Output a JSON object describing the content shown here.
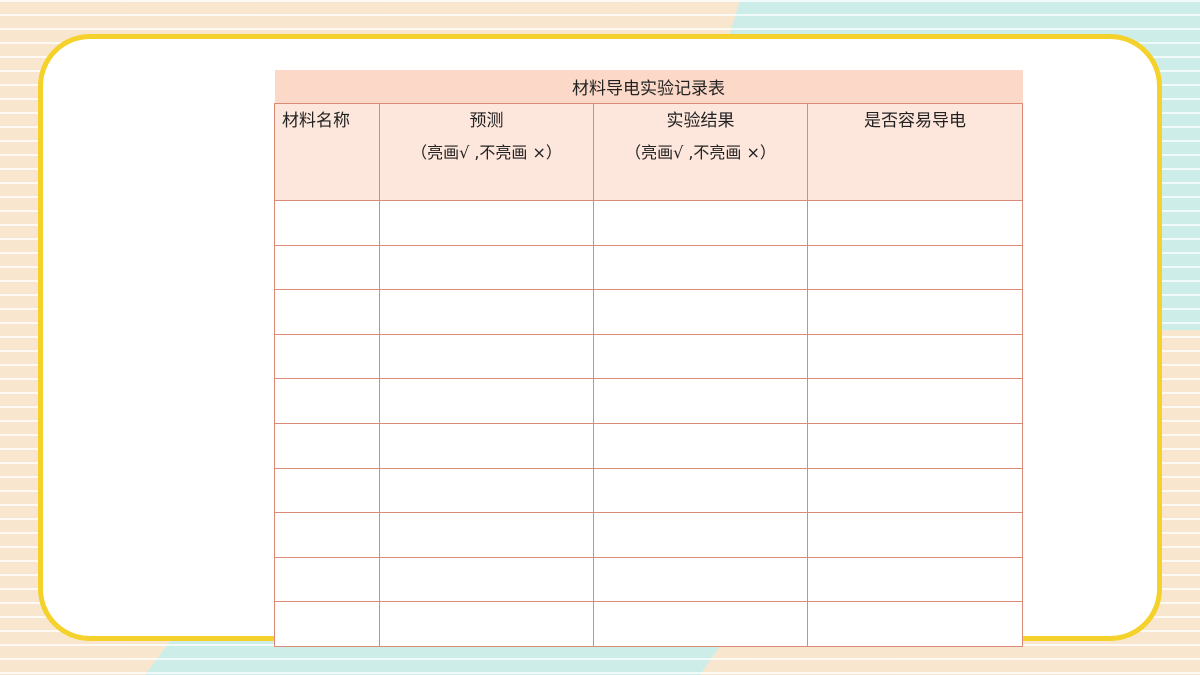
{
  "colors": {
    "background_peach": "#f9e6cf",
    "background_mint": "#cdeee8",
    "card_border": "#f5d22b",
    "table_title_fill": "#fbd8c7",
    "table_header_fill": "#fde6dc",
    "table_border": "#dc8a78"
  },
  "table": {
    "title": "材料导电实验记录表",
    "headers": [
      {
        "label": "材料名称",
        "sub": ""
      },
      {
        "label": "预测",
        "sub": "（亮画√ ,不亮画 ×）"
      },
      {
        "label": "实验结果",
        "sub": "（亮画√ ,不亮画 ×）"
      },
      {
        "label": "是否容易导电",
        "sub": ""
      }
    ],
    "rows": [
      [
        "",
        "",
        "",
        ""
      ],
      [
        "",
        "",
        "",
        ""
      ],
      [
        "",
        "",
        "",
        ""
      ],
      [
        "",
        "",
        "",
        ""
      ],
      [
        "",
        "",
        "",
        ""
      ],
      [
        "",
        "",
        "",
        ""
      ],
      [
        "",
        "",
        "",
        ""
      ],
      [
        "",
        "",
        "",
        ""
      ],
      [
        "",
        "",
        "",
        ""
      ],
      [
        "",
        "",
        "",
        ""
      ]
    ]
  }
}
